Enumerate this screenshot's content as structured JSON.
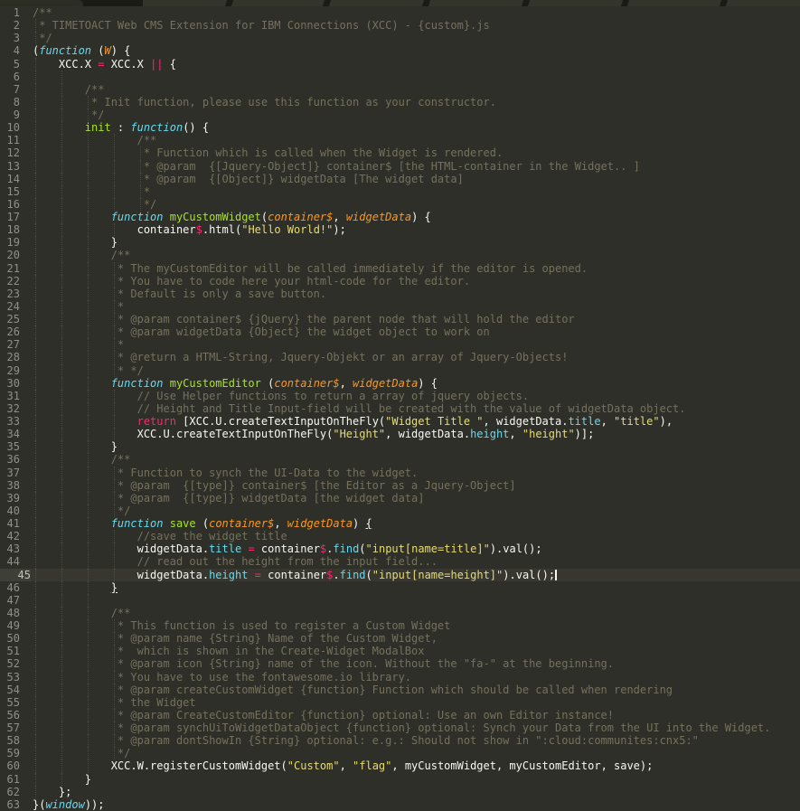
{
  "window": {
    "kind": "code-editor (Sublime Text, Monokai theme)",
    "file_language": "javascript"
  },
  "colors": {
    "background": "#2e2f28",
    "tabbar_background": "#1a1b15",
    "tab_active": "#33342c",
    "tab_inactive": "#2b2c24",
    "gutter_foreground": "#8f908a",
    "current_line_gutter": "#3e3f36",
    "comment": "#75715e",
    "foreground": "#f8f8f2",
    "keyword_pink": "#f92672",
    "function_green": "#a6e22e",
    "string_yellow": "#e6db74",
    "support_blue": "#66d9ef",
    "param_orange": "#fd971f"
  },
  "editor": {
    "current_line": 45,
    "cursor_line": 45,
    "first_line_number": 1,
    "lines": [
      [
        [
          "c",
          "/**"
        ]
      ],
      [
        [
          "c",
          " * TIMETOACT Web CMS Extension for IBM Connections (XCC) - {custom}.js"
        ]
      ],
      [
        [
          "c",
          " */"
        ]
      ],
      [
        [
          "w",
          "("
        ],
        [
          "bi",
          "function"
        ],
        [
          "w",
          " ("
        ],
        [
          "oi",
          "W"
        ],
        [
          "w",
          ") {"
        ]
      ],
      [
        [
          "w",
          "    XCC.X "
        ],
        [
          "p",
          "="
        ],
        [
          "w",
          " XCC.X "
        ],
        [
          "p",
          "||"
        ],
        [
          "w",
          " {"
        ]
      ],
      [],
      [
        [
          "c",
          "        /**"
        ]
      ],
      [
        [
          "c",
          "         * Init function, please use this function as your constructor."
        ]
      ],
      [
        [
          "c",
          "         */"
        ]
      ],
      [
        [
          "w",
          "        "
        ],
        [
          "g",
          "init"
        ],
        [
          "w",
          " : "
        ],
        [
          "bi",
          "function"
        ],
        [
          "w",
          "() {"
        ]
      ],
      [
        [
          "c",
          "                /**"
        ]
      ],
      [
        [
          "c",
          "                 * Function which is called when the Widget is rendered."
        ]
      ],
      [
        [
          "c",
          "                 * @param  {[Jquery-Object]} container$ [the HTML-container in the Widget.. ]"
        ]
      ],
      [
        [
          "c",
          "                 * @param  {[Object]} widgetData [The widget data]"
        ]
      ],
      [
        [
          "c",
          "                 *"
        ]
      ],
      [
        [
          "c",
          "                 */"
        ]
      ],
      [
        [
          "w",
          "            "
        ],
        [
          "bi",
          "function"
        ],
        [
          "w",
          " "
        ],
        [
          "g",
          "myCustomWidget"
        ],
        [
          "w",
          "("
        ],
        [
          "oi",
          "container$"
        ],
        [
          "w",
          ", "
        ],
        [
          "oi",
          "widgetData"
        ],
        [
          "w",
          ") {"
        ]
      ],
      [
        [
          "w",
          "                container"
        ],
        [
          "p",
          "$"
        ],
        [
          "w",
          ".html("
        ],
        [
          "y",
          "\"Hello World!\""
        ],
        [
          "w",
          ");"
        ]
      ],
      [
        [
          "w",
          "            }"
        ]
      ],
      [
        [
          "c",
          "            /**"
        ]
      ],
      [
        [
          "c",
          "             * The myCustomEditor will be called immediately if the editor is opened."
        ]
      ],
      [
        [
          "c",
          "             * You have to code here your html-code for the editor."
        ]
      ],
      [
        [
          "c",
          "             * Default is only a save button."
        ]
      ],
      [
        [
          "c",
          "             *"
        ]
      ],
      [
        [
          "c",
          "             * @param container$ {jQuery} the parent node that will hold the editor"
        ]
      ],
      [
        [
          "c",
          "             * @param widgetData {Object} the widget object to work on"
        ]
      ],
      [
        [
          "c",
          "             *"
        ]
      ],
      [
        [
          "c",
          "             * @return a HTML-String, Jquery-Objekt or an array of Jquery-Objects!"
        ]
      ],
      [
        [
          "c",
          "             * */"
        ]
      ],
      [
        [
          "w",
          "            "
        ],
        [
          "bi",
          "function"
        ],
        [
          "w",
          " "
        ],
        [
          "g",
          "myCustomEditor"
        ],
        [
          "w",
          " ("
        ],
        [
          "oi",
          "container$"
        ],
        [
          "w",
          ", "
        ],
        [
          "oi",
          "widgetData"
        ],
        [
          "w",
          ") {"
        ]
      ],
      [
        [
          "c",
          "                // Use Helper functions to return a array of jquery objects."
        ]
      ],
      [
        [
          "c",
          "                // Height and Title Input-field will be created with the value of widgetData object."
        ]
      ],
      [
        [
          "w",
          "                "
        ],
        [
          "p",
          "return"
        ],
        [
          "w",
          " [XCC.U.createTextInputOnTheFly("
        ],
        [
          "y",
          "\"Widget Title \""
        ],
        [
          "w",
          ", widgetData."
        ],
        [
          "n",
          "title"
        ],
        [
          "w",
          ", "
        ],
        [
          "y",
          "\"title\""
        ],
        [
          "w",
          "),"
        ]
      ],
      [
        [
          "w",
          "                XCC.U.createTextInputOnTheFly("
        ],
        [
          "y",
          "\"Height\""
        ],
        [
          "w",
          ", widgetData."
        ],
        [
          "n",
          "height"
        ],
        [
          "w",
          ", "
        ],
        [
          "y",
          "\"height\""
        ],
        [
          "w",
          ")];"
        ]
      ],
      [
        [
          "w",
          "            }"
        ]
      ],
      [
        [
          "c",
          "            /**"
        ]
      ],
      [
        [
          "c",
          "             * Function to synch the UI-Data to the widget."
        ]
      ],
      [
        [
          "c",
          "             * @param  {[type]} container$ [the Editor as a Jquery-Object]"
        ]
      ],
      [
        [
          "c",
          "             * @param  {[type]} widgetData [the widget data]"
        ]
      ],
      [
        [
          "c",
          "             */"
        ]
      ],
      [
        [
          "w",
          "            "
        ],
        [
          "bi",
          "function"
        ],
        [
          "w",
          " "
        ],
        [
          "g",
          "save"
        ],
        [
          "w",
          " ("
        ],
        [
          "oi",
          "container$"
        ],
        [
          "w",
          ", "
        ],
        [
          "oi",
          "widgetData"
        ],
        [
          "w",
          ") "
        ],
        [
          "mb",
          "{"
        ]
      ],
      [
        [
          "c",
          "                //save the widget title"
        ]
      ],
      [
        [
          "w",
          "                widgetData."
        ],
        [
          "n",
          "title"
        ],
        [
          "w",
          " "
        ],
        [
          "p",
          "="
        ],
        [
          "w",
          " container"
        ],
        [
          "p",
          "$"
        ],
        [
          "w",
          "."
        ],
        [
          "n",
          "find"
        ],
        [
          "w",
          "("
        ],
        [
          "y",
          "\"input[name=title]\""
        ],
        [
          "w",
          ").val();"
        ]
      ],
      [
        [
          "c",
          "                // read out the height from the input field..."
        ]
      ],
      [
        [
          "w",
          "                widgetData."
        ],
        [
          "n",
          "height"
        ],
        [
          "w",
          " "
        ],
        [
          "p",
          "="
        ],
        [
          "w",
          " container"
        ],
        [
          "p",
          "$"
        ],
        [
          "w",
          "."
        ],
        [
          "n",
          "find"
        ],
        [
          "w",
          "("
        ],
        [
          "y",
          "\"input[name=height]\""
        ],
        [
          "w",
          ").val();"
        ]
      ],
      [
        [
          "w",
          "            "
        ],
        [
          "mb",
          "}"
        ]
      ],
      [],
      [
        [
          "c",
          "            /**"
        ]
      ],
      [
        [
          "c",
          "             * This function is used to register a Custom Widget"
        ]
      ],
      [
        [
          "c",
          "             * @param name {String} Name of the Custom Widget,"
        ]
      ],
      [
        [
          "c",
          "             *  which is shown in the Create-Widget ModalBox"
        ]
      ],
      [
        [
          "c",
          "             * @param icon {String} name of the icon. Without the \"fa-\" at the beginning."
        ]
      ],
      [
        [
          "c",
          "             * You have to use the fontawesome.io library."
        ]
      ],
      [
        [
          "c",
          "             * @param createCustomWidget {function} Function which should be called when rendering"
        ]
      ],
      [
        [
          "c",
          "             * the Widget"
        ]
      ],
      [
        [
          "c",
          "             * @param CreateCustomEditor {function} optional: Use an own Editor instance!"
        ]
      ],
      [
        [
          "c",
          "             * @param synchUiToWidgetDataObject {function} optional: Synch your Data from the UI into the Widget."
        ]
      ],
      [
        [
          "c",
          "             * @param dontShowIn {String} optional: e.g.: Should not show in \":cloud:communites:cnx5:\""
        ]
      ],
      [
        [
          "c",
          "             */"
        ]
      ],
      [
        [
          "w",
          "            XCC.W.registerCustomWidget("
        ],
        [
          "y",
          "\"Custom\""
        ],
        [
          "w",
          ", "
        ],
        [
          "y",
          "\"flag\""
        ],
        [
          "w",
          ", myCustomWidget, myCustomEditor, save);"
        ]
      ],
      [
        [
          "w",
          "        }"
        ]
      ],
      [
        [
          "w",
          "    };"
        ]
      ],
      [
        [
          "w",
          "}("
        ],
        [
          "bi",
          "window"
        ],
        [
          "w",
          "));"
        ]
      ]
    ]
  }
}
